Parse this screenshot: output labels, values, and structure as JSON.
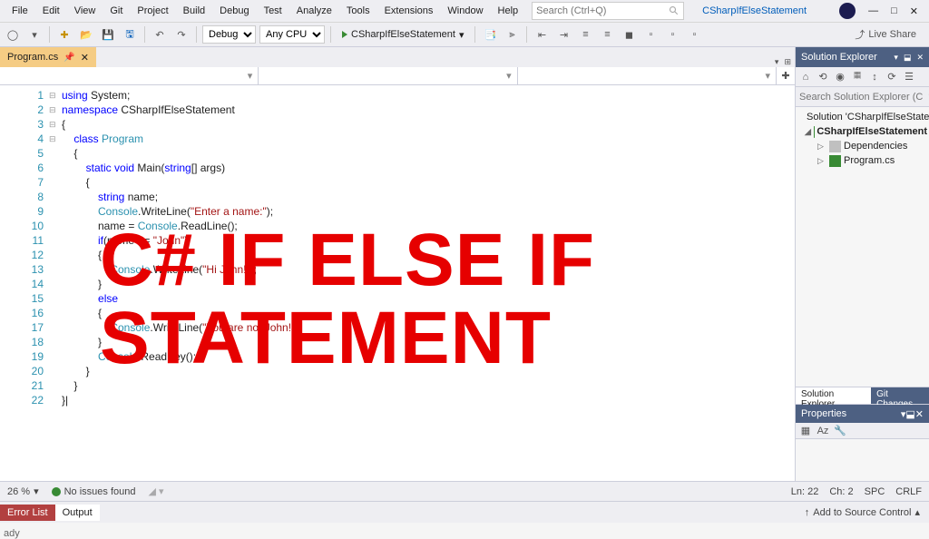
{
  "menu": {
    "items": [
      "File",
      "Edit",
      "View",
      "Git",
      "Project",
      "Build",
      "Debug",
      "Test",
      "Analyze",
      "Tools",
      "Extensions",
      "Window",
      "Help"
    ]
  },
  "search": {
    "placeholder": "Search (Ctrl+Q)"
  },
  "project_name": "CSharpIfElseStatement",
  "toolbar": {
    "config": "Debug",
    "platform": "Any CPU",
    "start_target": "CSharpIfElseStatement",
    "live_share": "Live Share"
  },
  "file_tab": {
    "name": "Program.cs"
  },
  "code_lines": [
    {
      "n": 1,
      "html": "<span class='kw'>using</span> System;"
    },
    {
      "n": 2,
      "html": "<span class='kw'>namespace</span> CSharpIfElseStatement"
    },
    {
      "n": 3,
      "html": "{"
    },
    {
      "n": 4,
      "html": "    <span class='kw'>class</span> <span class='cls'>Program</span>"
    },
    {
      "n": 5,
      "html": "    {"
    },
    {
      "n": 6,
      "html": "        <span class='kw'>static</span> <span class='kw'>void</span> Main(<span class='kw'>string</span>[] args)"
    },
    {
      "n": 7,
      "html": "        {"
    },
    {
      "n": 8,
      "html": "            <span class='kw'>string</span> name;"
    },
    {
      "n": 9,
      "html": "            <span class='cls'>Console</span>.WriteLine(<span class='str'>\"Enter a name:\"</span>);"
    },
    {
      "n": 10,
      "html": "            name = <span class='cls'>Console</span>.ReadLine();"
    },
    {
      "n": 11,
      "html": "            <span class='kw'>if</span>(name == <span class='str'>\"John\"</span>)"
    },
    {
      "n": 12,
      "html": "            {"
    },
    {
      "n": 13,
      "html": "                <span class='cls'>Console</span>.WriteLine(<span class='str'>\"Hi John!\"</span>);"
    },
    {
      "n": 14,
      "html": "            }"
    },
    {
      "n": 15,
      "html": "            <span class='kw'>else</span>"
    },
    {
      "n": 16,
      "html": "            {"
    },
    {
      "n": 17,
      "html": "                <span class='cls'>Console</span>.WriteLine(<span class='str'>\"You are not John!\"</span>);"
    },
    {
      "n": 18,
      "html": "            }"
    },
    {
      "n": 19,
      "html": "            <span class='cls'>Console</span>.ReadKey();"
    },
    {
      "n": 20,
      "html": "        }"
    },
    {
      "n": 21,
      "html": "    }"
    },
    {
      "n": 22,
      "html": "}|"
    }
  ],
  "fold": {
    "2": "⊟",
    "4": "",
    "6": "⊟",
    "11": "⊟",
    "15": "⊟"
  },
  "overlay": {
    "line1": "C# IF ELSE IF",
    "line2": "STATEMENT"
  },
  "solution_explorer": {
    "title": "Solution Explorer",
    "search_placeholder": "Search Solution Explorer (C",
    "solution_label": "Solution 'CSharpIfElseStater",
    "project_label": "CSharpIfElseStatement",
    "deps_label": "Dependencies",
    "progfile_label": "Program.cs",
    "tab_se": "Solution Explorer",
    "tab_git": "Git Changes"
  },
  "properties": {
    "title": "Properties"
  },
  "status": {
    "zoom": "26 %",
    "issues": "No issues found",
    "ln": "Ln: 22",
    "ch": "Ch: 2",
    "spc": "SPC",
    "crlf": "CRLF",
    "ready": "ady"
  },
  "bottom": {
    "error_list": "Error List",
    "output": "Output",
    "add_source": "Add to Source Control"
  }
}
